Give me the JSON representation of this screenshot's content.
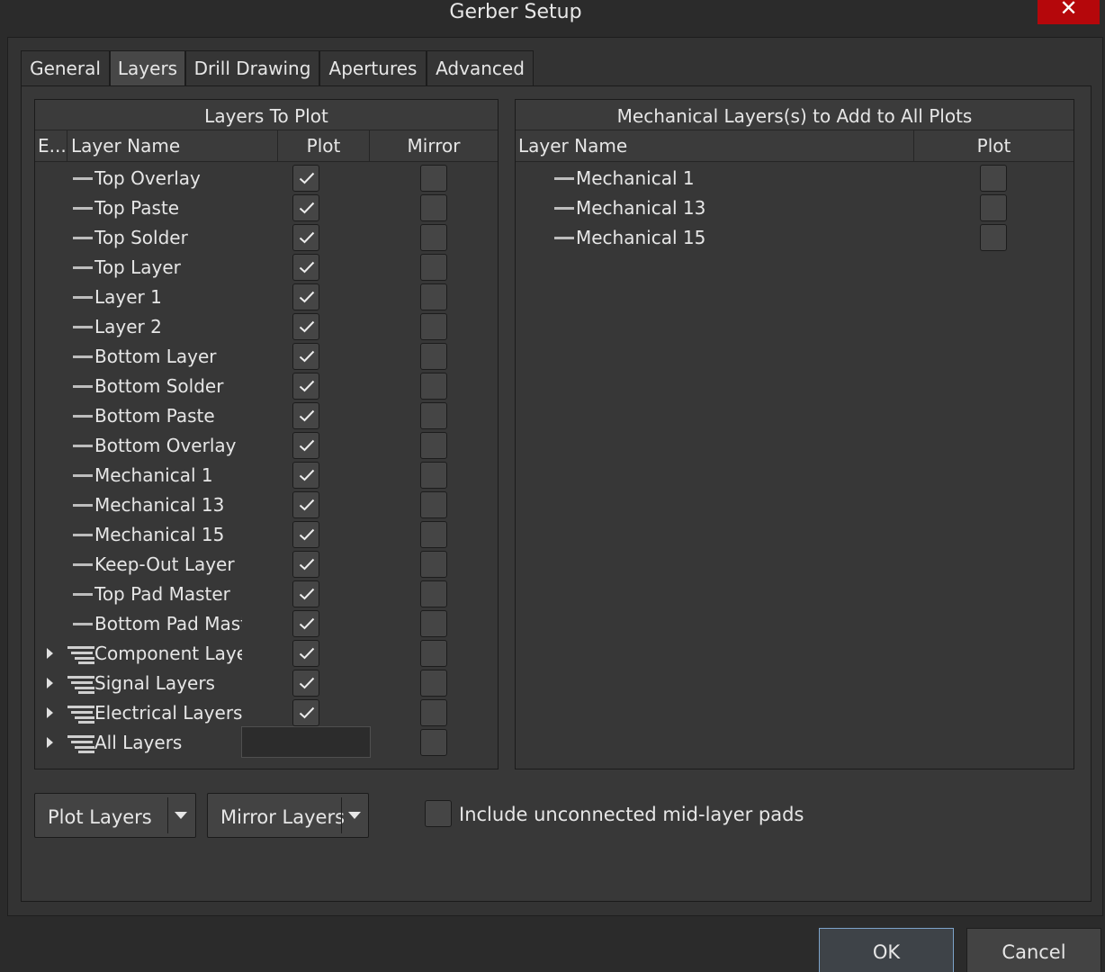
{
  "window": {
    "title": "Gerber Setup",
    "close_glyph": "✕"
  },
  "tabs": [
    {
      "label": "General",
      "active": false
    },
    {
      "label": "Layers",
      "active": true
    },
    {
      "label": "Drill Drawing",
      "active": false
    },
    {
      "label": "Apertures",
      "active": false
    },
    {
      "label": "Advanced",
      "active": false
    }
  ],
  "layers_panel": {
    "title": "Layers To Plot",
    "columns": {
      "expand": "E...",
      "name": "Layer Name",
      "plot": "Plot",
      "mirror": "Mirror"
    },
    "rows": [
      {
        "name": "Top Overlay",
        "kind": "layer",
        "plot": true,
        "mirror": false
      },
      {
        "name": "Top Paste",
        "kind": "layer",
        "plot": true,
        "mirror": false
      },
      {
        "name": "Top Solder",
        "kind": "layer",
        "plot": true,
        "mirror": false
      },
      {
        "name": "Top Layer",
        "kind": "layer",
        "plot": true,
        "mirror": false
      },
      {
        "name": "Layer 1",
        "kind": "layer",
        "plot": true,
        "mirror": false
      },
      {
        "name": "Layer 2",
        "kind": "layer",
        "plot": true,
        "mirror": false
      },
      {
        "name": "Bottom Layer",
        "kind": "layer",
        "plot": true,
        "mirror": false
      },
      {
        "name": "Bottom Solder",
        "kind": "layer",
        "plot": true,
        "mirror": false
      },
      {
        "name": "Bottom Paste",
        "kind": "layer",
        "plot": true,
        "mirror": false
      },
      {
        "name": "Bottom Overlay",
        "kind": "layer",
        "plot": true,
        "mirror": false
      },
      {
        "name": "Mechanical 1",
        "kind": "layer",
        "plot": true,
        "mirror": false
      },
      {
        "name": "Mechanical 13",
        "kind": "layer",
        "plot": true,
        "mirror": false
      },
      {
        "name": "Mechanical 15",
        "kind": "layer",
        "plot": true,
        "mirror": false
      },
      {
        "name": "Keep-Out Layer",
        "kind": "layer",
        "plot": true,
        "mirror": false
      },
      {
        "name": "Top Pad Master",
        "kind": "layer",
        "plot": true,
        "mirror": false
      },
      {
        "name": "Bottom Pad Mast",
        "kind": "layer",
        "plot": true,
        "mirror": false
      },
      {
        "name": "Component Laye",
        "kind": "group",
        "plot": true,
        "mirror": false
      },
      {
        "name": "Signal Layers",
        "kind": "group",
        "plot": true,
        "mirror": false
      },
      {
        "name": "Electrical Layers",
        "kind": "group",
        "plot": true,
        "mirror": false
      },
      {
        "name": "All Layers",
        "kind": "group",
        "plot": true,
        "mirror": false
      }
    ]
  },
  "mech_panel": {
    "title": "Mechanical Layers(s) to Add to All Plots",
    "columns": {
      "name": "Layer Name",
      "plot": "Plot"
    },
    "rows": [
      {
        "name": "Mechanical 1",
        "plot": false
      },
      {
        "name": "Mechanical 13",
        "plot": false
      },
      {
        "name": "Mechanical 15",
        "plot": false
      }
    ]
  },
  "controls": {
    "plot_layers": "Plot Layers",
    "mirror_layers": "Mirror Layers",
    "include_unconnected_label": "Include unconnected mid-layer pads",
    "include_unconnected_checked": false
  },
  "buttons": {
    "ok": "OK",
    "cancel": "Cancel"
  },
  "colors": {
    "background": "#2b2b2b",
    "close_button": "#b5070b",
    "default_button_border": "#7da3c9"
  }
}
